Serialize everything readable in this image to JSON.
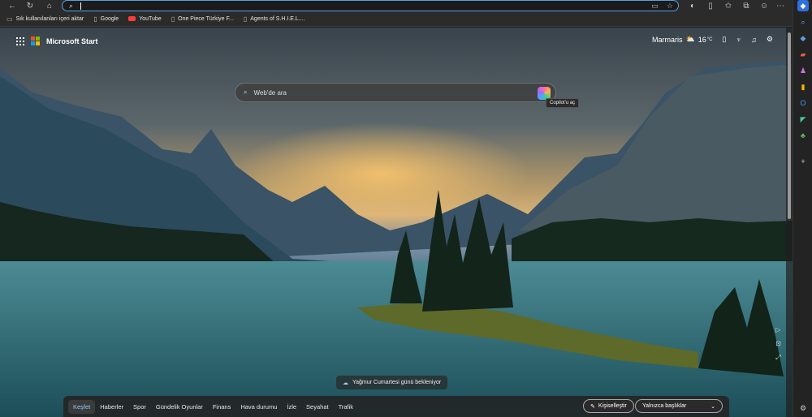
{
  "browser": {
    "address_value": "",
    "bookmarks": [
      {
        "label": "Sık kullanılanları içeri aktar",
        "icon": "folder-icon"
      },
      {
        "label": "Google",
        "icon": "page-icon"
      },
      {
        "label": "YouTube",
        "icon": "youtube-icon"
      },
      {
        "label": "One Piece Türkiye F...",
        "icon": "page-icon"
      },
      {
        "label": "Agents of S.H.I.E.L....",
        "icon": "page-icon"
      }
    ]
  },
  "page": {
    "brand": "Microsoft Start",
    "location": "Marmaris",
    "temperature": "16",
    "temperature_unit": "°C",
    "search_placeholder": "Web'de ara",
    "copilot_tooltip": "Copilot'u aç",
    "weather_notice": "Yağmur Cumartesi günü bekleniyor"
  },
  "nav": {
    "items": [
      "Keşfet",
      "Haberler",
      "Spor",
      "Gündelik Oyunlar",
      "Finans",
      "Hava durumu",
      "İzle",
      "Seyahat",
      "Trafik"
    ],
    "personalize": "Kişiselleştir",
    "feed_mode": "Yalnızca başlıklar"
  },
  "colors": {
    "accent": "#5aa0e6",
    "active_tab": "#8fc8ff",
    "logo": [
      "#f25022",
      "#7fba00",
      "#00a4ef",
      "#ffb900"
    ]
  }
}
